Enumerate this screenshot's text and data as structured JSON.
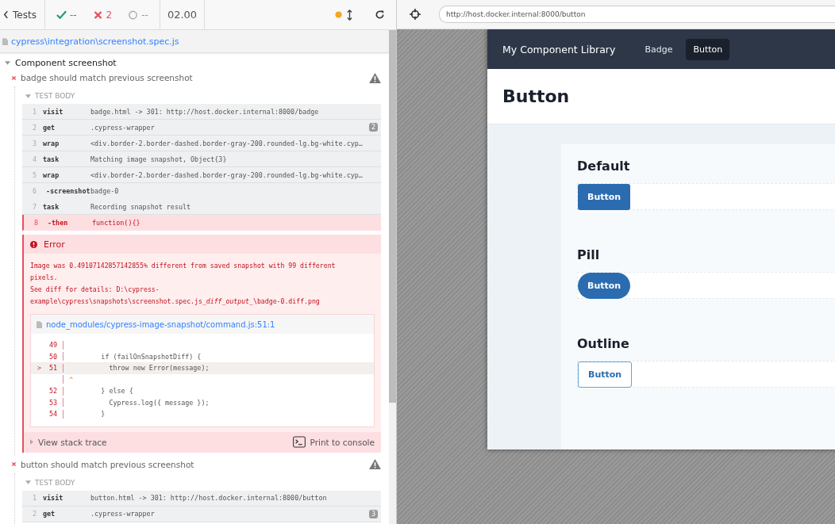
{
  "reporter": {
    "back_label": "Tests",
    "stats": {
      "passed": "--",
      "failed": "2",
      "pending": "--",
      "duration": "02.00"
    },
    "spec_file": "cypress\\integration\\screenshot.spec.js",
    "suite": {
      "title": "Component screenshot"
    },
    "tests": [
      {
        "title": "badge should match previous screenshot",
        "failed": true,
        "body_label": "TEST BODY",
        "commands": [
          {
            "number": "1",
            "name": "visit",
            "message": "badge.html -> 301: http://host.docker.internal:8000/badge",
            "kind": "parent",
            "failed": false
          },
          {
            "number": "2",
            "name": "get",
            "message": ".cypress-wrapper",
            "badge": "2",
            "kind": "parent",
            "failed": false
          },
          {
            "number": "3",
            "name": "wrap",
            "message": "<div.border-2.border-dashed.border-gray-200.rounded-lg.bg-white.cyp…",
            "kind": "parent",
            "failed": false
          },
          {
            "number": "4",
            "name": "task",
            "message": "Matching image snapshot, Object{3}",
            "kind": "parent",
            "failed": false
          },
          {
            "number": "5",
            "name": "wrap",
            "message": "<div.border-2.border-dashed.border-gray-200.rounded-lg.bg-white.cyp…",
            "kind": "parent",
            "failed": false
          },
          {
            "number": "6",
            "name": "-screenshot",
            "message": "badge-0",
            "kind": "child",
            "failed": false
          },
          {
            "number": "7",
            "name": "task",
            "message": "Recording snapshot result",
            "kind": "parent",
            "failed": false
          },
          {
            "number": "8",
            "name": "-then",
            "message": "function(){}",
            "kind": "child",
            "failed": true
          }
        ],
        "error": {
          "title": "Error",
          "message": [
            [
              {
                "text": "Image was 0.49107142857142855% different from saved snapshot with 99 different pixels.",
                "italic": false
              }
            ],
            [
              {
                "text": "See diff for details: D:\\cypress-example\\cypress\\snapshots\\screenshot.spec.js",
                "italic": false
              },
              {
                "text": "_diff_output_",
                "italic": true
              },
              {
                "text": "\\badge-0.diff.png",
                "italic": false
              }
            ]
          ],
          "code_file": "node_modules/cypress-image-snapshot/command.js:51:1",
          "code_lines": [
            {
              "number": "49",
              "current": false
            },
            {
              "number": "50",
              "code": "        if (failOnSnapshotDiff) {",
              "current": false
            },
            {
              "number": "51",
              "code": "          throw new Error(message);",
              "current": true,
              "pointer": ">"
            },
            {
              "code": "^",
              "current": false
            },
            {
              "number": "52",
              "code": "        } else {",
              "current": false
            },
            {
              "number": "53",
              "code": "          Cypress.log({ message });",
              "current": false
            },
            {
              "number": "54",
              "code": "        }",
              "current": false
            }
          ],
          "stack_label": "View stack trace",
          "console_label": "Print to console"
        }
      },
      {
        "title": "button should match previous screenshot",
        "failed": true,
        "body_label": "TEST BODY",
        "commands": [
          {
            "number": "1",
            "name": "visit",
            "message": "button.html -> 301: http://host.docker.internal:8000/button",
            "kind": "parent",
            "failed": false
          },
          {
            "number": "2",
            "name": "get",
            "message": ".cypress-wrapper",
            "badge": "3",
            "kind": "parent",
            "failed": false
          }
        ]
      }
    ]
  },
  "browser": {
    "url": "http://host.docker.internal:8000/button",
    "app": {
      "brand": "My Component Library",
      "nav": [
        {
          "label": "Badge",
          "selected": false
        },
        {
          "label": "Button",
          "selected": true
        }
      ],
      "heading": "Button",
      "sections": [
        {
          "title": "Default",
          "button": "Button",
          "kind": "solid"
        },
        {
          "title": "Pill",
          "button": "Button",
          "kind": "pill"
        },
        {
          "title": "Outline",
          "button": "Button",
          "kind": "outline"
        }
      ]
    }
  }
}
